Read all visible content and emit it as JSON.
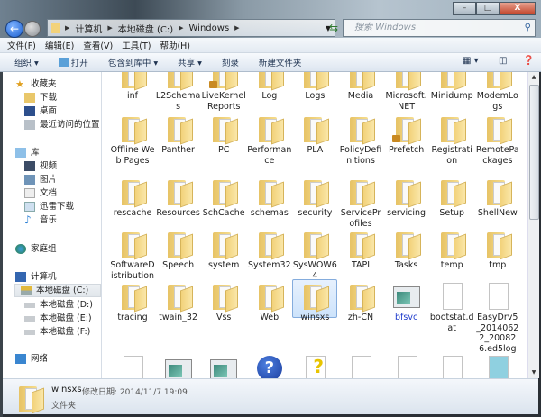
{
  "window": {
    "controls": {
      "minimize": "–",
      "maximize": "□",
      "close": "X"
    }
  },
  "nav": {
    "back_icon": "back-arrow-icon",
    "forward_icon": "forward-arrow-icon"
  },
  "address": {
    "crumbs": [
      "计算机",
      "本地磁盘 (C:)",
      "Windows"
    ]
  },
  "search": {
    "placeholder": "搜索 Windows"
  },
  "menu": [
    "文件(F)",
    "编辑(E)",
    "查看(V)",
    "工具(T)",
    "帮助(H)"
  ],
  "toolbar": {
    "organize": "组织 ▾",
    "open": "打开",
    "include": "包含到库中 ▾",
    "share": "共享 ▾",
    "burn": "刻录",
    "new_folder": "新建文件夹"
  },
  "sidebar": {
    "favorites": "收藏夹",
    "downloads": "下载",
    "desktop": "桌面",
    "recent": "最近访问的位置",
    "library": "库",
    "videos": "视频",
    "pictures": "图片",
    "documents": "文档",
    "xunlei": "迅雷下载",
    "music": "音乐",
    "homegroup": "家庭组",
    "computer": "计算机",
    "drive_c": "本地磁盘 (C:)",
    "drive_d": "本地磁盘 (D:)",
    "drive_e": "本地磁盘 (E:)",
    "drive_f": "本地磁盘 (F:)",
    "network": "网络"
  },
  "items": [
    {
      "name": "inf",
      "type": "folder"
    },
    {
      "name": "L2Schemas",
      "type": "folder"
    },
    {
      "name": "LiveKernelReports",
      "type": "folder",
      "locked": true
    },
    {
      "name": "Log",
      "type": "folder"
    },
    {
      "name": "Logs",
      "type": "folder"
    },
    {
      "name": "Media",
      "type": "folder"
    },
    {
      "name": "Microsoft.NET",
      "type": "folder"
    },
    {
      "name": "Minidump",
      "type": "folder"
    },
    {
      "name": "ModemLogs",
      "type": "folder"
    },
    {
      "name": "Offline Web Pages",
      "type": "folder"
    },
    {
      "name": "Panther",
      "type": "folder"
    },
    {
      "name": "PC",
      "type": "folder"
    },
    {
      "name": "Performance",
      "type": "folder"
    },
    {
      "name": "PLA",
      "type": "folder"
    },
    {
      "name": "PolicyDefinitions",
      "type": "folder"
    },
    {
      "name": "Prefetch",
      "type": "folder",
      "locked": true
    },
    {
      "name": "Registration",
      "type": "folder"
    },
    {
      "name": "RemotePackages",
      "type": "folder"
    },
    {
      "name": "rescache",
      "type": "folder"
    },
    {
      "name": "Resources",
      "type": "folder"
    },
    {
      "name": "SchCache",
      "type": "folder"
    },
    {
      "name": "schemas",
      "type": "folder"
    },
    {
      "name": "security",
      "type": "folder"
    },
    {
      "name": "ServiceProfiles",
      "type": "folder"
    },
    {
      "name": "servicing",
      "type": "folder"
    },
    {
      "name": "Setup",
      "type": "folder"
    },
    {
      "name": "ShellNew",
      "type": "folder"
    },
    {
      "name": "SoftwareDistribution",
      "type": "folder"
    },
    {
      "name": "Speech",
      "type": "folder"
    },
    {
      "name": "system",
      "type": "folder"
    },
    {
      "name": "System32",
      "type": "folder"
    },
    {
      "name": "SysWOW64",
      "type": "folder"
    },
    {
      "name": "TAPI",
      "type": "folder"
    },
    {
      "name": "Tasks",
      "type": "folder"
    },
    {
      "name": "temp",
      "type": "folder"
    },
    {
      "name": "tmp",
      "type": "folder"
    },
    {
      "name": "tracing",
      "type": "folder"
    },
    {
      "name": "twain_32",
      "type": "folder"
    },
    {
      "name": "Vss",
      "type": "folder"
    },
    {
      "name": "Web",
      "type": "folder"
    },
    {
      "name": "winsxs",
      "type": "folder",
      "selected": true
    },
    {
      "name": "zh-CN",
      "type": "folder"
    },
    {
      "name": "bfsvc",
      "type": "exe",
      "compressed": true
    },
    {
      "name": "bootstat.dat",
      "type": "file"
    },
    {
      "name": "EasyDrv5_20140622_200826.ed5log",
      "type": "file"
    },
    {
      "name": "",
      "type": "config-file"
    },
    {
      "name": "",
      "type": "explorer"
    },
    {
      "name": "",
      "type": "exe"
    },
    {
      "name": "",
      "type": "help"
    },
    {
      "name": "",
      "type": "help-file"
    },
    {
      "name": "",
      "type": "file"
    },
    {
      "name": "",
      "type": "file"
    },
    {
      "name": "",
      "type": "config-file"
    },
    {
      "name": "",
      "type": "notepad"
    }
  ],
  "status": {
    "name": "winsxs",
    "modified": "修改日期: 2014/11/7 19:09",
    "type": "文件夹"
  },
  "colors": {
    "selection": "#cde3fb",
    "compressed_text": "#1f3ccc",
    "folder": "#f2d27a"
  }
}
